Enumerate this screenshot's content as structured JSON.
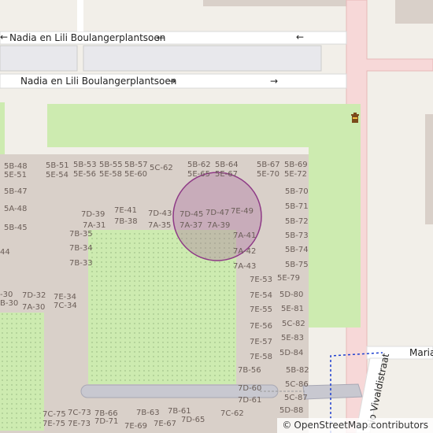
{
  "streets": {
    "top_label": "Nadia en Lili Boulangerplantsoen",
    "top_arrow_inline": "←",
    "top_arrow_right": "←",
    "bottom_label": "Nadia en Lili Boulangerplantsoen",
    "bottom_arrow_inline": "→",
    "bottom_arrow_right": "→",
    "right_street_partial": "Maria",
    "diagonal_street_partial": "nio Vivaldistraat"
  },
  "labels": [
    {
      "t": "5B-48"
    },
    {
      "t": "5E-51"
    },
    {
      "t": "5B-47"
    },
    {
      "t": "5A-48"
    },
    {
      "t": "5B-45"
    },
    {
      "t": "44"
    },
    {
      "t": "5B-51"
    },
    {
      "t": "5E-54"
    },
    {
      "t": "5B-53"
    },
    {
      "t": "5E-56"
    },
    {
      "t": "5B-55"
    },
    {
      "t": "5E-58"
    },
    {
      "t": "5B-57"
    },
    {
      "t": "5E-60"
    },
    {
      "t": "5C-62"
    },
    {
      "t": "5B-62"
    },
    {
      "t": "5E-65"
    },
    {
      "t": "5B-64"
    },
    {
      "t": "5E-67"
    },
    {
      "t": "5B-67"
    },
    {
      "t": "5E-70"
    },
    {
      "t": "5B-69"
    },
    {
      "t": "5E-72"
    },
    {
      "t": "5B-70"
    },
    {
      "t": "5B-71"
    },
    {
      "t": "5B-72"
    },
    {
      "t": "5B-73"
    },
    {
      "t": "5B-74"
    },
    {
      "t": "5B-75"
    },
    {
      "t": "7D-39"
    },
    {
      "t": "7A-31"
    },
    {
      "t": "7E-41"
    },
    {
      "t": "7B-38"
    },
    {
      "t": "7D-43"
    },
    {
      "t": "7A-35"
    },
    {
      "t": "7D-45"
    },
    {
      "t": "7A-37"
    },
    {
      "t": "7D-47"
    },
    {
      "t": "7A-39"
    },
    {
      "t": "7E-49"
    },
    {
      "t": "7A-41"
    },
    {
      "t": "7A-42"
    },
    {
      "t": "7A-43"
    },
    {
      "t": "7B-35"
    },
    {
      "t": "7B-34"
    },
    {
      "t": "7B-33"
    },
    {
      "t": "-30"
    },
    {
      "t": "B-30"
    },
    {
      "t": "7D-32"
    },
    {
      "t": "7A-30"
    },
    {
      "t": "7E-34"
    },
    {
      "t": "7C-34"
    },
    {
      "t": "7E-53"
    },
    {
      "t": "5E-79"
    },
    {
      "t": "7E-54"
    },
    {
      "t": "5D-80"
    },
    {
      "t": "7E-55"
    },
    {
      "t": "5E-81"
    },
    {
      "t": "7E-56"
    },
    {
      "t": "5C-82"
    },
    {
      "t": "7E-57"
    },
    {
      "t": "5E-83"
    },
    {
      "t": "7E-58"
    },
    {
      "t": "5D-84"
    },
    {
      "t": "7B-56"
    },
    {
      "t": "5B-82"
    },
    {
      "t": "5C-86"
    },
    {
      "t": "7D-60"
    },
    {
      "t": "7D-61"
    },
    {
      "t": "5C-87"
    },
    {
      "t": "5D-88"
    },
    {
      "t": "7C-75"
    },
    {
      "t": "7E-75"
    },
    {
      "t": "7C-73"
    },
    {
      "t": "7E-73"
    },
    {
      "t": "7B-66"
    },
    {
      "t": "7D-71"
    },
    {
      "t": "7B-63"
    },
    {
      "t": "7E-69"
    },
    {
      "t": "7B-61"
    },
    {
      "t": "7E-67"
    },
    {
      "t": "7D-65"
    },
    {
      "t": "7C-62"
    }
  ],
  "colors": {
    "background": "#f2efe9",
    "building_block": "#d9d0c9",
    "grass": "#cdebb0",
    "road_pink": "#f7d8d8",
    "road_gray": "#c8c8d0",
    "circle_fill": "#a86a9e",
    "circle_stroke": "#8e3a86",
    "path_blue": "#1e3fd0"
  },
  "marker": {
    "icon": "waste-basket-icon"
  },
  "attribution": {
    "copyright_symbol": "©",
    "text": "OpenStreetMap contributors"
  }
}
